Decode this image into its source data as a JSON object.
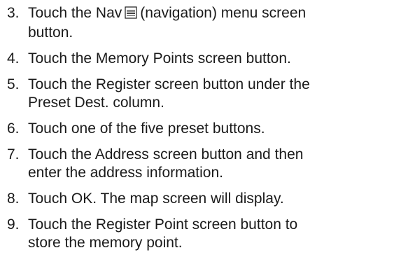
{
  "steps": [
    {
      "number": "3.",
      "line1_pre": "Touch the Nav",
      "icon": "nav-menu-icon",
      "line1_post": "(navigation) menu screen",
      "line2": "button."
    },
    {
      "number": "4.",
      "line1": "Touch the Memory Points screen button."
    },
    {
      "number": "5.",
      "line1": "Touch the Register screen button under the",
      "line2": "Preset Dest. column."
    },
    {
      "number": "6.",
      "line1": "Touch one of the five preset buttons."
    },
    {
      "number": "7.",
      "line1": "Touch the Address screen button and then",
      "line2": "enter the address information."
    },
    {
      "number": "8.",
      "line1": "Touch OK. The map screen will display."
    },
    {
      "number": "9.",
      "line1": "Touch the Register Point screen button to",
      "line2": "store the memory point."
    }
  ]
}
